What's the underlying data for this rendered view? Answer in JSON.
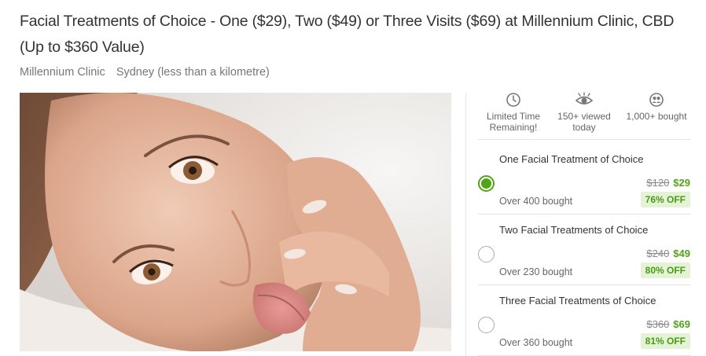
{
  "deal": {
    "title": "Facial Treatments of Choice - One ($29), Two ($49) or Three Visits ($69) at Millennium Clinic, CBD (Up to $360 Value)",
    "merchant": "Millennium Clinic",
    "location": "Sydney (less than a kilometre)"
  },
  "stats": [
    {
      "icon": "clock-icon",
      "label": "Limited Time Remaining!"
    },
    {
      "icon": "eye-icon",
      "label": "150+ viewed today"
    },
    {
      "icon": "people-icon",
      "label": "1,000+ bought"
    }
  ],
  "options": [
    {
      "title": "One Facial Treatment of Choice",
      "original_price": "$120",
      "sale_price": "$29",
      "discount": "76% OFF",
      "bought": "Over 400 bought",
      "selected": true
    },
    {
      "title": "Two Facial Treatments of Choice",
      "original_price": "$240",
      "sale_price": "$49",
      "discount": "80% OFF",
      "bought": "Over 230 bought",
      "selected": false
    },
    {
      "title": "Three Facial Treatments of Choice",
      "original_price": "$360",
      "sale_price": "$69",
      "discount": "81% OFF",
      "bought": "Over 360 bought",
      "selected": false
    }
  ],
  "colors": {
    "accent": "#53a318",
    "discount_bg": "#e4f3d6"
  }
}
